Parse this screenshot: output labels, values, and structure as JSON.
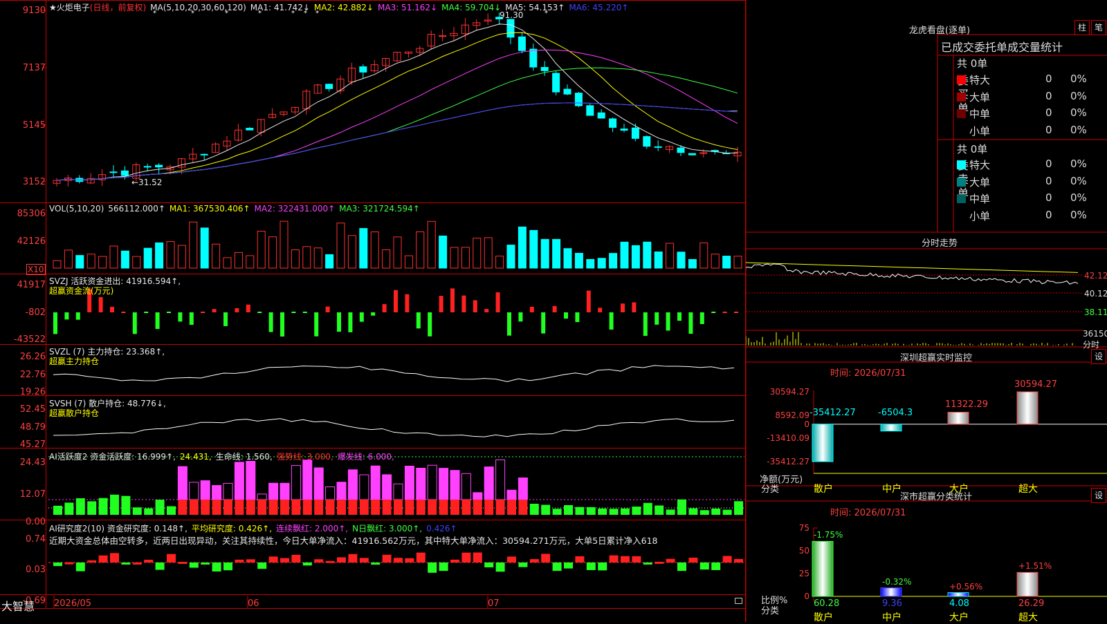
{
  "main": {
    "star": "★",
    "stock": "火炬电子",
    "mode": "(日线，前复权)",
    "ma_def": "MA(5,10,20,30,60,120)",
    "ma": [
      {
        "t": "MA1: 41.742↓",
        "c": "#e8e8e8"
      },
      {
        "t": "MA2: 42.882↓",
        "c": "#ffff00"
      },
      {
        "t": "MA3: 51.162↓",
        "c": "#ff40ff"
      },
      {
        "t": "MA4: 59.704↓",
        "c": "#40ff40"
      },
      {
        "t": "MA5: 54.153↑",
        "c": "#e8e8e8"
      },
      {
        "t": "MA6: 45.220↑",
        "c": "#4040ff"
      }
    ],
    "axis": [
      "9130",
      "7137",
      "5145",
      "3152"
    ],
    "high_label": "91.30",
    "low_label": "←31.52"
  },
  "vol": {
    "title": "VOL(5,10,20)",
    "items": [
      {
        "t": "566112.000↑",
        "c": "#e8e8e8"
      },
      {
        "t": "MA1: 367530.406↑",
        "c": "#ffff00"
      },
      {
        "t": "MA2: 322431.000↑",
        "c": "#ff40ff"
      },
      {
        "t": "MA3: 321724.594↑",
        "c": "#40ff40"
      }
    ],
    "axis": [
      "85306",
      "42126"
    ],
    "unit": "X10"
  },
  "svzj": {
    "title": "SVZJ  活跃资金进出: 41916.594↑,",
    "sub": "超赢资金流(万元)",
    "axis": [
      "41917",
      "-802",
      "-43522"
    ]
  },
  "svzl": {
    "title": "SVZL  (7) 主力持仓: 23.368↑,",
    "sub": "超赢主力持仓",
    "axis": [
      "26.26",
      "22.76",
      "19.26"
    ]
  },
  "svsh": {
    "title": "SVSH  (7) 散户持仓: 48.776↓,",
    "sub": "超赢散户持仓",
    "axis": [
      "52.45",
      "48.79",
      "45.27"
    ]
  },
  "ai1": {
    "items": [
      {
        "t": "AI活跃度2 资金活跃度: 16.999↑,",
        "c": "#e8e8e8"
      },
      {
        "t": "24.431,",
        "c": "#ffff00"
      },
      {
        "t": "生命线: 1.560,",
        "c": "#e8e8e8"
      },
      {
        "t": "强势线: 3.000,",
        "c": "#ff3030"
      },
      {
        "t": "爆发线: 6.000,",
        "c": "#ff40ff"
      }
    ],
    "axis": [
      "24.43",
      "12.07",
      "0.00"
    ]
  },
  "ai2": {
    "items": [
      {
        "t": "AI研究度2(10) 资金研究度: 0.148↑,",
        "c": "#e8e8e8"
      },
      {
        "t": "平均研究度: 0.426↑,",
        "c": "#ffff00"
      },
      {
        "t": "连续飘红: 2.000↑,",
        "c": "#ff40ff"
      },
      {
        "t": "N日飘红: 3.000↑,",
        "c": "#40ff40"
      },
      {
        "t": "0.426↑",
        "c": "#4040ff"
      }
    ],
    "desc": "近期大资金总体由空转多，近两日出现异动，关注其持续性，今日大单净流入：41916.562万元，其中特大单净流入：30594.271万元，大单5日累计净入618",
    "axis": [
      "0.74",
      "0.03",
      "-0.69"
    ]
  },
  "bottom": {
    "brand": "大智慧",
    "d1": "2026/05",
    "d2": "06",
    "d3": "07"
  },
  "lhb": {
    "title": "龙虎看盘(逐单)",
    "btn1": "柱",
    "btn2": "笔",
    "tab": "已成交委托单成交量统计",
    "buy_label": "委买单",
    "sell_label": "委卖单",
    "buy_total": "共 0单",
    "sell_total": "共 0单",
    "buy": [
      {
        "name": "特大",
        "v": "0",
        "p": "0%",
        "c": "#ff0000"
      },
      {
        "name": "大单",
        "v": "0",
        "p": "0%",
        "c": "#a00000"
      },
      {
        "name": "中单",
        "v": "0",
        "p": "0%",
        "c": "#700000"
      },
      {
        "name": "小单",
        "v": "0",
        "p": "0%",
        "c": "#000000"
      }
    ],
    "sell": [
      {
        "name": "特大",
        "v": "0",
        "p": "0%",
        "c": "#00ffff"
      },
      {
        "name": "大单",
        "v": "0",
        "p": "0%",
        "c": "#008080"
      },
      {
        "name": "中单",
        "v": "0",
        "p": "0%",
        "c": "#006060"
      },
      {
        "name": "小单",
        "v": "0",
        "p": "0%",
        "c": "#000000"
      }
    ]
  },
  "fs": {
    "title": "分时走势",
    "axis": [
      "42.12",
      "40.12",
      "38.11"
    ],
    "vol": "36150",
    "vol_unit": "分时"
  },
  "sz": {
    "title": "深圳超赢实时监控",
    "btn": "设",
    "time": "时间: 2026/07/31",
    "axis": [
      "30594.27",
      "8592.09",
      "0",
      "-13410.09",
      "-35412.27"
    ],
    "ylabel1": "净额(万元)",
    "ylabel2": "分类",
    "cats": [
      "散户",
      "中户",
      "大户",
      "超大"
    ],
    "labels": [
      "-35412.27",
      "-6504.3",
      "11322.29",
      "30594.27"
    ]
  },
  "sc": {
    "title": "深市超赢分类统计",
    "btn": "设",
    "time": "时间: 2026/07/31",
    "axis": [
      "75",
      "50",
      "25",
      "0"
    ],
    "ylabel1": "比例%",
    "ylabel2": "分类",
    "cats": [
      "散户",
      "中户",
      "大户",
      "超大"
    ],
    "top": [
      "-1.75%",
      "-0.32%",
      "+0.56%",
      "+1.51%"
    ],
    "bot": [
      "60.28",
      "9.36",
      "4.08",
      "26.29"
    ]
  },
  "chart_data": [
    {
      "type": "bar",
      "title": "深圳超赢实时监控",
      "categories": [
        "散户",
        "中户",
        "大户",
        "超大"
      ],
      "values": [
        -35412.27,
        -6504.3,
        11322.29,
        30594.27
      ],
      "ylabel": "净额(万元)",
      "ylim": [
        -35412.27,
        30594.27
      ]
    },
    {
      "type": "bar",
      "title": "深市超赢分类统计",
      "categories": [
        "散户",
        "中户",
        "大户",
        "超大"
      ],
      "values": [
        60.28,
        9.36,
        4.08,
        26.29
      ],
      "changes": [
        "-1.75%",
        "-0.32%",
        "+0.56%",
        "+1.51%"
      ],
      "ylabel": "比例%",
      "ylim": [
        0,
        75
      ]
    }
  ]
}
